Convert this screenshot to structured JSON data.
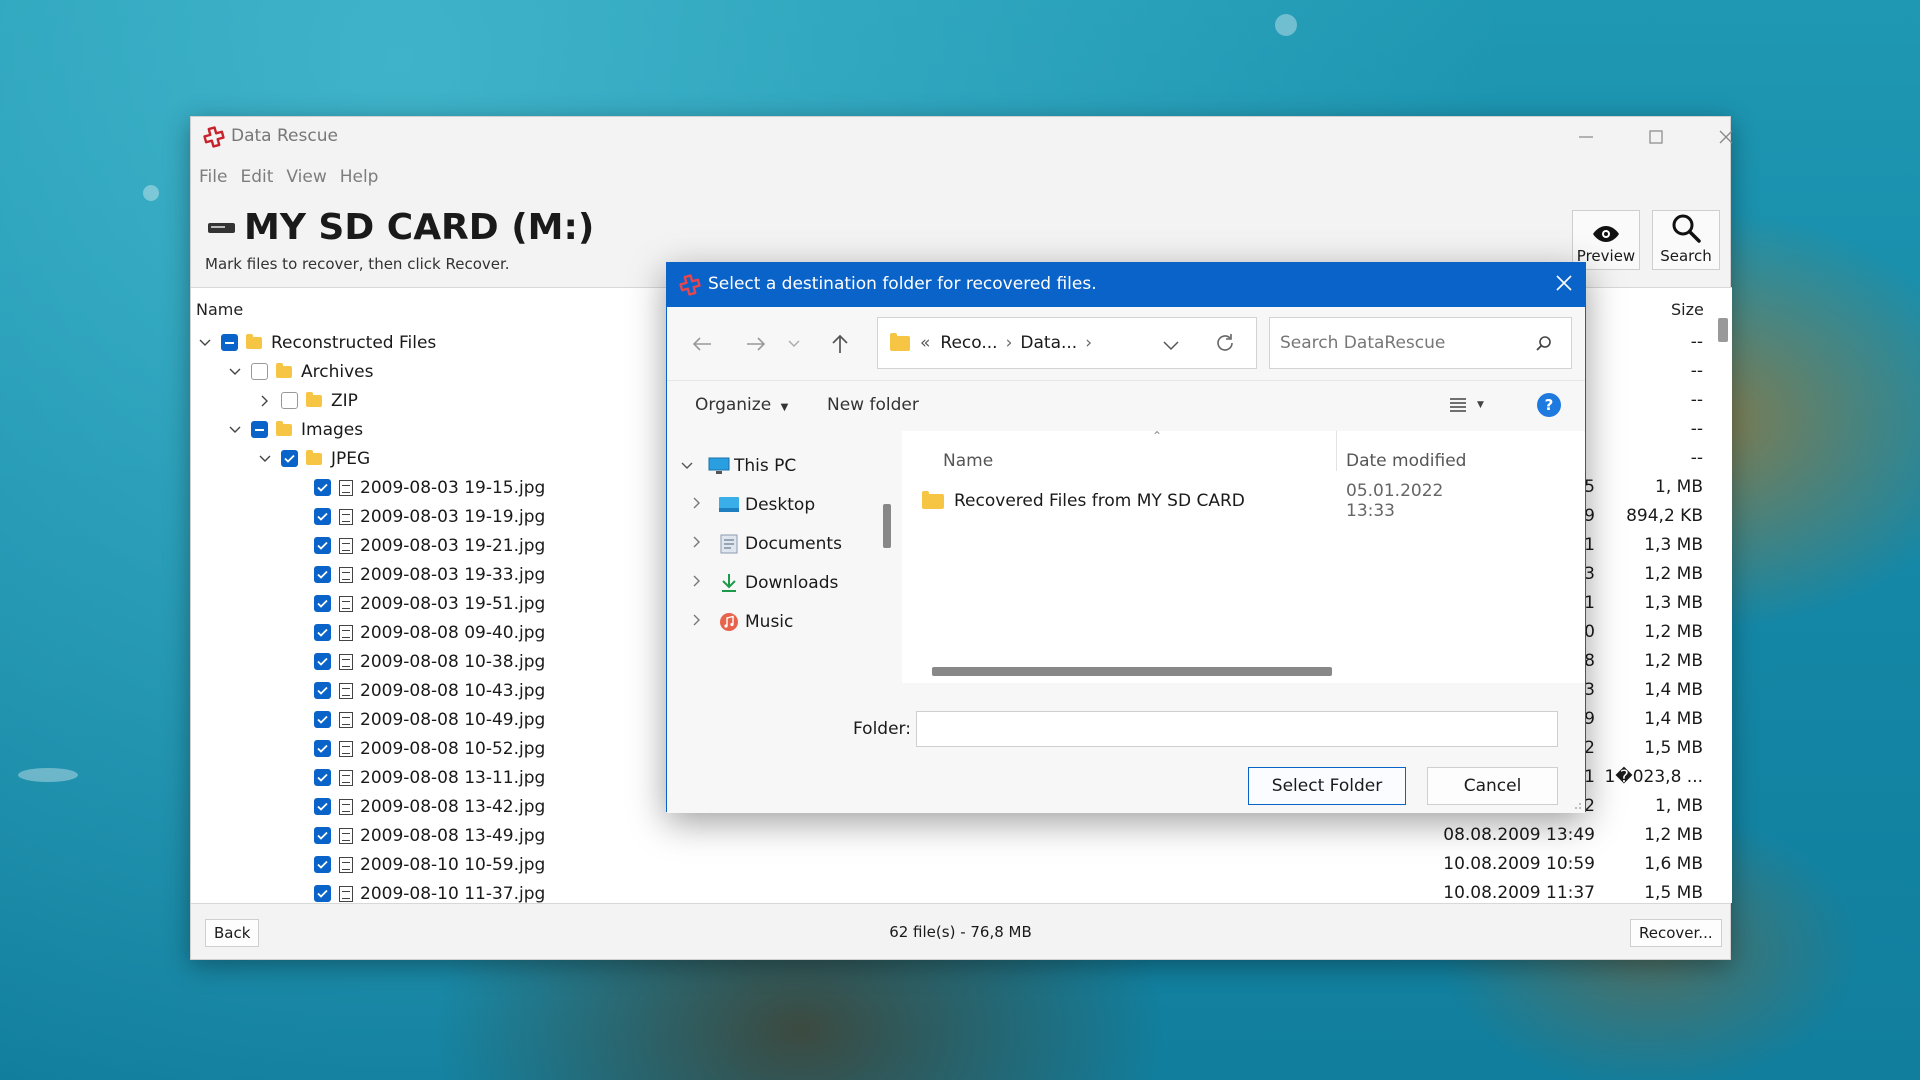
{
  "app": {
    "title": "Data Rescue",
    "brand_color": "#c8232c"
  },
  "menu": [
    "File",
    "Edit",
    "View",
    "Help"
  ],
  "header": {
    "drive_title": "MY SD CARD (M:)",
    "subtitle": "Mark files to recover, then click Recover.",
    "preview_label": "Preview",
    "search_label": "Search"
  },
  "columns": {
    "name": "Name",
    "size": "Size"
  },
  "tree": [
    {
      "label": "Reconstructed Files",
      "level": 0,
      "expander": "down",
      "check": "partial",
      "icon": "folder-icon",
      "size": "--"
    },
    {
      "label": "Archives",
      "level": 1,
      "expander": "down",
      "check": "unchecked",
      "icon": "folder-icon",
      "size": "--"
    },
    {
      "label": "ZIP",
      "level": 2,
      "expander": "right",
      "check": "unchecked",
      "icon": "folder-icon",
      "size": "--"
    },
    {
      "label": "Images",
      "level": 1,
      "expander": "down",
      "check": "partial",
      "icon": "folder-icon",
      "size": "--"
    },
    {
      "label": "JPEG",
      "level": 2,
      "expander": "down",
      "check": "checked",
      "icon": "folder-icon",
      "size": "--"
    }
  ],
  "files": [
    {
      "name": "2009-08-03 19-15.jpg",
      "date_tail": "5",
      "size": "1, MB"
    },
    {
      "name": "2009-08-03 19-19.jpg",
      "date_tail": "9",
      "size": "894,2 KB"
    },
    {
      "name": "2009-08-03 19-21.jpg",
      "date_tail": "1",
      "size": "1,3 MB"
    },
    {
      "name": "2009-08-03 19-33.jpg",
      "date_tail": "3",
      "size": "1,2 MB"
    },
    {
      "name": "2009-08-03 19-51.jpg",
      "date_tail": "1",
      "size": "1,3 MB"
    },
    {
      "name": "2009-08-08 09-40.jpg",
      "date_tail": "0",
      "size": "1,2 MB"
    },
    {
      "name": "2009-08-08 10-38.jpg",
      "date_tail": "8",
      "size": "1,2 MB"
    },
    {
      "name": "2009-08-08 10-43.jpg",
      "date_tail": "3",
      "size": "1,4 MB"
    },
    {
      "name": "2009-08-08 10-49.jpg",
      "date_tail": "9",
      "size": "1,4 MB"
    },
    {
      "name": "2009-08-08 10-52.jpg",
      "date_tail": "2",
      "size": "1,5 MB"
    },
    {
      "name": "2009-08-08 13-11.jpg",
      "date_tail": "1",
      "size": "1�023,8 ..."
    },
    {
      "name": "2009-08-08 13-42.jpg",
      "date_tail": "2",
      "size": "1, MB"
    },
    {
      "name": "2009-08-08 13-49.jpg",
      "date_tail": "08.08.2009 13:49",
      "size": "1,2 MB"
    },
    {
      "name": "2009-08-10 10-59.jpg",
      "date_tail": "10.08.2009 10:59",
      "size": "1,6 MB"
    },
    {
      "name": "2009-08-10 11-37.jpg",
      "date_tail": "10.08.2009 11:37",
      "size": "1,5 MB"
    }
  ],
  "footer": {
    "back_label": "Back",
    "status": "62 file(s) - 76,8 MB",
    "recover_label": "Recover..."
  },
  "dialog": {
    "title": "Select a destination folder for recovered files.",
    "address": {
      "prefix": "«",
      "parts": [
        "Reco...",
        "Data..."
      ]
    },
    "search_placeholder": "Search DataRescue",
    "organize_label": "Organize",
    "new_folder_label": "New folder",
    "help_label": "?",
    "nav_items": [
      {
        "label": "This PC",
        "expander": "down",
        "icon": "monitor-icon"
      },
      {
        "label": "Desktop",
        "expander": "right",
        "icon": "desktop-icon"
      },
      {
        "label": "Documents",
        "expander": "right",
        "icon": "documents-icon"
      },
      {
        "label": "Downloads",
        "expander": "right",
        "icon": "download-icon"
      },
      {
        "label": "Music",
        "expander": "right",
        "icon": "music-icon"
      }
    ],
    "file_columns": {
      "name": "Name",
      "date": "Date modified"
    },
    "folder_row": {
      "name": "Recovered Files from MY SD CARD",
      "date": "05.01.2022 13:33"
    },
    "folder_label": "Folder:",
    "folder_value": "",
    "select_label": "Select Folder",
    "cancel_label": "Cancel",
    "accent_color": "#0a63c9"
  }
}
